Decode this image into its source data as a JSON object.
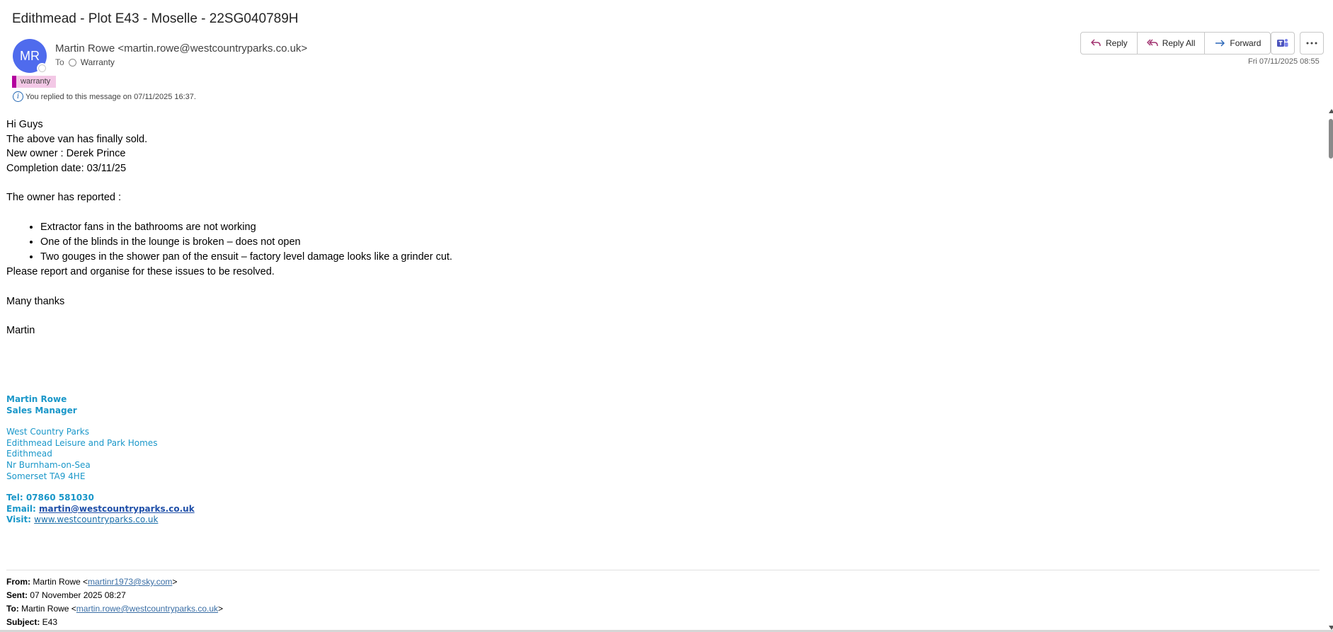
{
  "subject": "Edithmead - Plot E43 - Moselle - 22SG040789H",
  "sender": {
    "initials": "MR",
    "display": "Martin Rowe <martin.rowe@westcountryparks.co.uk>",
    "to_label": "To",
    "to_recipient": "Warranty"
  },
  "category": "warranty",
  "replied_notice": "You replied to this message on 07/11/2025 16:37.",
  "toolbar": {
    "reply": "Reply",
    "reply_all": "Reply All",
    "forward": "Forward"
  },
  "date": "Fri 07/11/2025 08:55",
  "body": {
    "greeting": "Hi Guys",
    "line1": "The above van has finally sold.",
    "line2": "New owner : Derek Prince",
    "line3": "Completion date: 03/11/25",
    "reported": "The owner has reported :",
    "bullets": [
      "Extractor fans in the bathrooms are not working",
      "One of the blinds in the lounge is broken – does not open",
      "Two gouges in the shower pan of the ensuit – factory level damage looks like a grinder cut."
    ],
    "request": "Please report and organise for these issues to be resolved.",
    "thanks": "Many thanks",
    "name": "Martin"
  },
  "signature": {
    "name": "Martin Rowe",
    "title": "Sales Manager",
    "address": [
      "West Country Parks",
      "Edithmead Leisure and Park Homes",
      "Edithmead",
      "Nr Burnham-on-Sea",
      "Somerset TA9 4HE"
    ],
    "tel": "Tel: 07860 581030",
    "email_label": "Email: ",
    "email": "martin@westcountryparks.co.uk",
    "visit_label": "Visit: ",
    "visit": "www.westcountryparks.co.uk"
  },
  "quoted": {
    "from_label": "From:",
    "from_name": " Martin Rowe <",
    "from_email": "martinr1973@sky.com",
    "from_close": ">",
    "sent_label": "Sent:",
    "sent": " 07 November 2025 08:27",
    "to_label": "To:",
    "to_name": " Martin Rowe <",
    "to_email": "martin.rowe@westcountryparks.co.uk",
    "to_close": ">",
    "subject_label": "Subject:",
    "subject": " E43"
  },
  "icons": {
    "reply": "reply-icon",
    "reply_all": "reply-all-icon",
    "forward": "forward-icon",
    "teams": "teams-icon",
    "more": "more-icon",
    "info": "info-icon"
  },
  "colors": {
    "avatar": "#4f6bed",
    "category_bg": "#f3c8e6",
    "category_bar": "#b4009e",
    "signature": "#1a97c9",
    "reply_icon": "#a0306e",
    "forward_icon": "#2a66b8"
  }
}
